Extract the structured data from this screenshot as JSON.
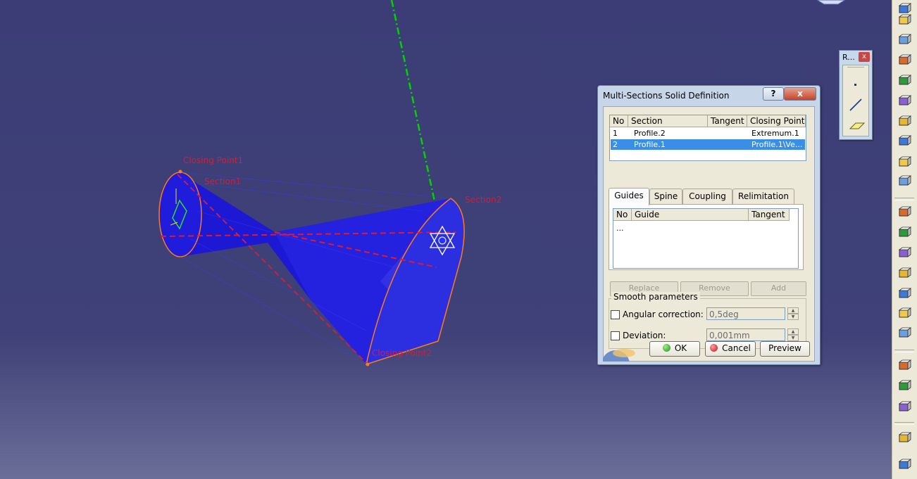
{
  "viewport": {
    "labels": {
      "closing_point1": "Closing Point1",
      "section1": "Section1",
      "section2": "Section2",
      "closing_point2": "Closing Point2"
    },
    "colors": {
      "background_top": "#3c3d76",
      "solid": "#1a16d8",
      "axis_line": "#00d400",
      "label": "#e2192c",
      "edge": "#ff7a1a"
    }
  },
  "ref_toolbar": {
    "title": "R...",
    "close_label": "x",
    "icons": [
      "point-icon",
      "line-icon",
      "plane-icon"
    ]
  },
  "dialog": {
    "title": "Multi-Sections Solid Definition",
    "help_label": "?",
    "close_label": "x",
    "sections_table": {
      "headers": [
        "No",
        "Section",
        "Tangent",
        "Closing Point"
      ],
      "rows": [
        {
          "no": "1",
          "section": "Profile.2",
          "tangent": "",
          "closing_point": "Extremum.1"
        },
        {
          "no": "2",
          "section": "Profile.1",
          "tangent": "",
          "closing_point": "Profile.1\\Ve..."
        }
      ],
      "selected_row": 2
    },
    "tabs": [
      "Guides",
      "Spine",
      "Coupling",
      "Relimitation"
    ],
    "active_tab": "Guides",
    "guides_table": {
      "headers": [
        "No",
        "Guide",
        "Tangent"
      ],
      "rows": [
        {
          "no": "...",
          "guide": "",
          "tangent": ""
        }
      ]
    },
    "buttons": {
      "replace": "Replace",
      "remove": "Remove",
      "add": "Add",
      "ok": "OK",
      "cancel": "Cancel",
      "preview": "Preview"
    },
    "smooth": {
      "legend": "Smooth parameters",
      "angular_label": "Angular correction:",
      "angular_value": "0,5deg",
      "angular_checked": false,
      "deviation_label": "Deviation:",
      "deviation_value": "0,001mm",
      "deviation_checked": false
    }
  },
  "right_toolbar": {
    "icons": [
      "pad-icon",
      "pocket-icon",
      "shaft-icon",
      "groove-icon",
      "hole-icon",
      "rib-icon",
      "slot-icon",
      "stiffener-icon",
      "multi-sections-solid-icon",
      "removed-multi-sections-icon",
      "fillet-icon",
      "chamfer-icon",
      "draft-icon",
      "shell-icon",
      "thickness-icon",
      "thread-icon",
      "remove-face-icon",
      "replace-face-icon",
      "text-annotation-icon",
      "flag-note-icon",
      "measure-icon",
      "analysis-icon",
      "boolean-icon"
    ]
  }
}
